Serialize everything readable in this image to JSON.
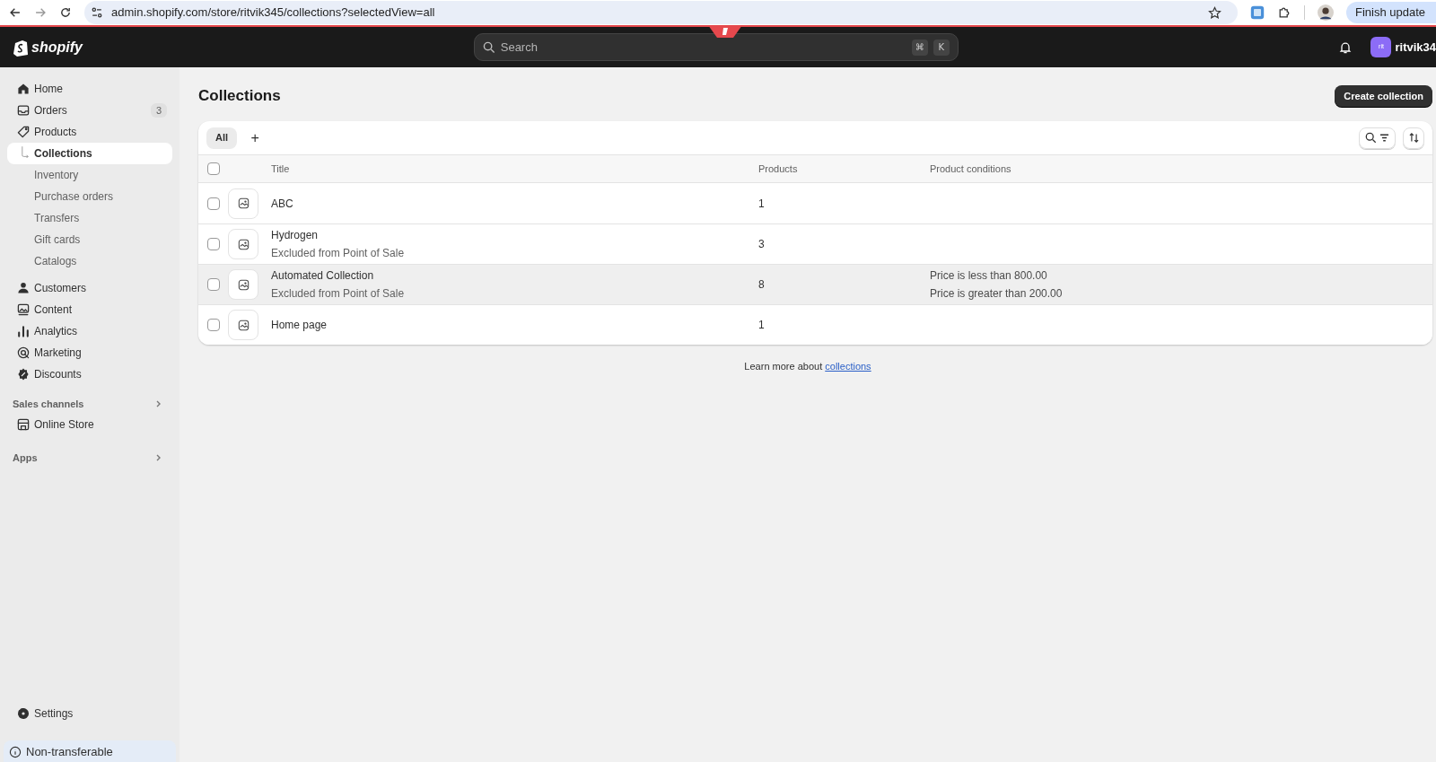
{
  "browser": {
    "url": "admin.shopify.com/store/ritvik345/collections?selectedView=all",
    "update_button": "Finish update"
  },
  "topbar": {
    "brand": "shopify",
    "search": {
      "placeholder": "Search",
      "shortcut": [
        "⌘",
        "K"
      ]
    },
    "avatar": "rit",
    "user": "ritvik34"
  },
  "sidebar": {
    "items": [
      {
        "kind": "main",
        "label": "Home",
        "selected": false
      },
      {
        "kind": "main",
        "label": "Orders",
        "badge": "3",
        "selected": false
      },
      {
        "kind": "main",
        "label": "Products",
        "selected": false
      },
      {
        "kind": "sub",
        "label": "Collections",
        "selected": true
      },
      {
        "kind": "sub",
        "label": "Inventory",
        "selected": false
      },
      {
        "kind": "sub",
        "label": "Purchase orders",
        "selected": false
      },
      {
        "kind": "sub",
        "label": "Transfers",
        "selected": false
      },
      {
        "kind": "sub",
        "label": "Gift cards",
        "selected": false
      },
      {
        "kind": "sub",
        "label": "Catalogs",
        "selected": false
      },
      {
        "kind": "main",
        "label": "Customers",
        "selected": false
      },
      {
        "kind": "main",
        "label": "Content",
        "selected": false
      },
      {
        "kind": "main",
        "label": "Analytics",
        "selected": false
      },
      {
        "kind": "main",
        "label": "Marketing",
        "selected": false
      },
      {
        "kind": "main",
        "label": "Discounts",
        "selected": false
      }
    ],
    "sales_channels": {
      "heading": "Sales channels",
      "items": [
        {
          "label": "Online Store",
          "selected": false
        }
      ]
    },
    "apps": {
      "heading": "Apps"
    },
    "settings": "Settings",
    "notice": "Non-transferable"
  },
  "page": {
    "title": "Collections",
    "primary_action": "Create collection"
  },
  "views": [
    {
      "label": "All",
      "selected": true
    }
  ],
  "add_view": "+",
  "table": {
    "select_all_checked": false,
    "columns": [
      "Title",
      "Products",
      "Product conditions"
    ],
    "rows": [
      {
        "title": "ABC",
        "products": "1",
        "checked": false,
        "highlighted": false
      },
      {
        "title": "Hydrogen",
        "subtitle": "Excluded from Point of Sale",
        "products": "3",
        "checked": false,
        "highlighted": false
      },
      {
        "title": "Automated Collection",
        "subtitle": "Excluded from Point of Sale",
        "products": "8",
        "conditions": [
          "Price is less than 800.00",
          "Price is greater than 200.00"
        ],
        "checked": false,
        "highlighted": true
      },
      {
        "title": "Home page",
        "products": "1",
        "checked": false,
        "highlighted": false
      }
    ]
  },
  "footer": {
    "text": "Learn more about",
    "link": "collections"
  }
}
